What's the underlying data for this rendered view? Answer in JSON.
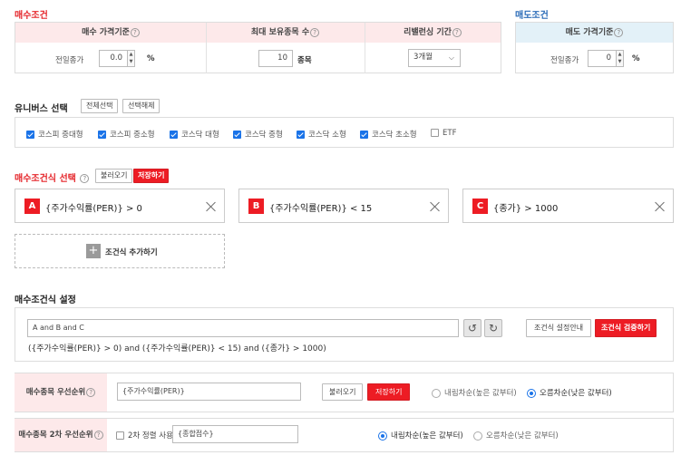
{
  "buy_conditions": {
    "title": "매수조건",
    "col1_header": "매수 가격기준",
    "col2_header": "최대 보유종목 수",
    "col3_header": "리밸런싱 기간",
    "price_basis_label": "전일종가",
    "price_value": "0.0",
    "price_unit": "%",
    "max_holdings_value": "10",
    "max_holdings_unit": "종목",
    "rebalance_selected": "3개월"
  },
  "sell_conditions": {
    "title": "매도조건",
    "header": "매도 가격기준",
    "price_basis_label": "전일종가",
    "price_value": "0",
    "price_unit": "%"
  },
  "universe": {
    "title": "유니버스 선택",
    "select_all": "전체선택",
    "deselect_all": "선택해제",
    "items": [
      {
        "label": "코스피 중대형",
        "checked": true
      },
      {
        "label": "코스피 중소형",
        "checked": true
      },
      {
        "label": "코스닥 대형",
        "checked": true
      },
      {
        "label": "코스닥 중형",
        "checked": true
      },
      {
        "label": "코스닥 소형",
        "checked": true
      },
      {
        "label": "코스닥 초소형",
        "checked": true
      },
      {
        "label": "ETF",
        "checked": false
      }
    ]
  },
  "buy_formula": {
    "title": "매수조건식 선택",
    "load_label": "불러오기",
    "save_label": "저장하기",
    "conditions": [
      {
        "letter": "A",
        "text": "{주가수익률(PER)} > 0"
      },
      {
        "letter": "B",
        "text": "{주가수익률(PER)} < 15"
      },
      {
        "letter": "C",
        "text": "{종가} > 1000"
      }
    ],
    "add_label": "조건식 추가하기"
  },
  "formula_settings": {
    "title": "매수조건식 설정",
    "expression": "A and B and C",
    "expanded": "({주가수익률(PER)} > 0) and ({주가수익률(PER)} < 15) and ({종가} > 1000)",
    "guide_label": "조건식 설정안내",
    "verify_label": "조건식 검증하기"
  },
  "priority": {
    "label": "매수종목 우선순위",
    "value": "{주가수익률(PER)}",
    "load_label": "불러오기",
    "save_label": "저장하기",
    "desc_label": "내림차순(높은 값부터)",
    "asc_label": "오름차순(낮은 값부터)",
    "selected": "asc"
  },
  "priority2": {
    "label": "매수종목 2차 우선순위",
    "secondary_sort_label": "2차 정렬 사용",
    "value": "{종합점수}",
    "desc_label": "내림차순(높은 값부터)",
    "asc_label": "오름차순(낮은 값부터)",
    "selected": "desc"
  }
}
